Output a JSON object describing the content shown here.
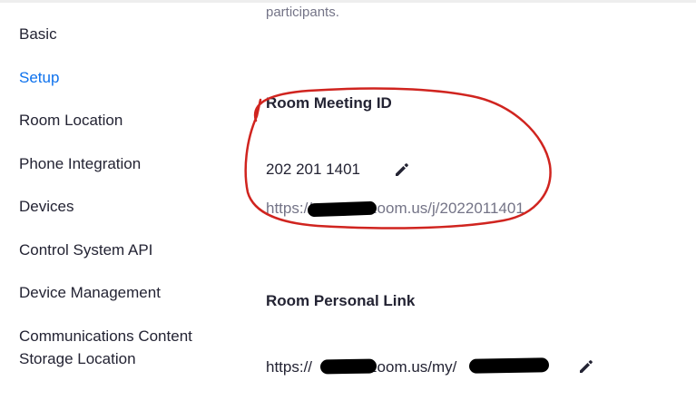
{
  "sidebar": {
    "items": [
      {
        "label": "Basic",
        "active": false
      },
      {
        "label": "Setup",
        "active": true
      },
      {
        "label": "Room Location",
        "active": false
      },
      {
        "label": "Phone Integration",
        "active": false
      },
      {
        "label": "Devices",
        "active": false
      },
      {
        "label": "Control System API",
        "active": false
      },
      {
        "label": "Device Management",
        "active": false
      },
      {
        "label": "Communications Content Storage Location",
        "active": false
      }
    ],
    "item_lines": {
      "comms_line1": "Communications Content",
      "comms_line2": "Storage Location"
    }
  },
  "main": {
    "intro_text": "participants.",
    "meeting_id": {
      "title": "Room Meeting ID",
      "value": "202 201 1401",
      "link_prefix": "https://",
      "link_suffix": "zoom.us/j/2022011401",
      "edit_icon": "pencil-icon"
    },
    "personal_link": {
      "title": "Room Personal Link",
      "link_prefix": "https://",
      "link_suffix": "zoom.us/my/",
      "edit_icon": "pencil-icon"
    }
  },
  "colors": {
    "accent": "#0e72ed",
    "text": "#232333",
    "muted": "#747487",
    "annotation": "#d0241f"
  }
}
